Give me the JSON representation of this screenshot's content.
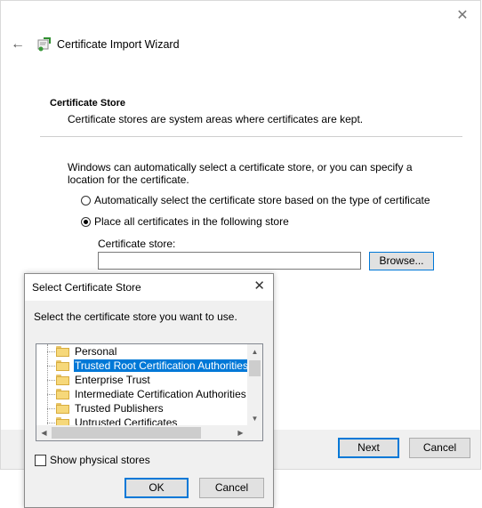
{
  "wizard": {
    "title": "Certificate Import Wizard",
    "close_icon": "close-icon",
    "back_icon": "back-arrow-icon",
    "section_title": "Certificate Store",
    "section_desc": "Certificate stores are system areas where certificates are kept.",
    "intro": "Windows can automatically select a certificate store, or you can specify a location for the certificate.",
    "radio_auto": "Automatically select the certificate store based on the type of certificate",
    "radio_place": "Place all certificates in the following store",
    "radio_selected": "place",
    "store_label": "Certificate store:",
    "store_value": "",
    "browse_label": "Browse...",
    "next_label": "Next",
    "cancel_label": "Cancel"
  },
  "dialog": {
    "title": "Select Certificate Store",
    "instruction": "Select the certificate store you want to use.",
    "stores": [
      "Personal",
      "Trusted Root Certification Authorities",
      "Enterprise Trust",
      "Intermediate Certification Authorities",
      "Trusted Publishers",
      "Untrusted Certificates"
    ],
    "selected_store": "Trusted Root Certification Authorities",
    "show_physical_label": "Show physical stores",
    "show_physical_checked": false,
    "ok_label": "OK",
    "cancel_label": "Cancel"
  },
  "colors": {
    "accent": "#0078d7",
    "dialog_bg": "#f0f0f0",
    "folder": "#f6d87a"
  }
}
